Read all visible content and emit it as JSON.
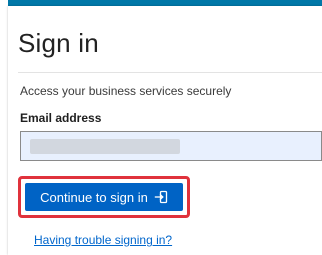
{
  "signin": {
    "title": "Sign in",
    "subtitle": "Access your business services securely",
    "email_label": "Email address",
    "email_value": "",
    "continue_label": "Continue to sign in",
    "continue_icon": "sign-in-arrow-icon",
    "trouble_link": "Having trouble signing in?"
  },
  "colors": {
    "accent_bar": "#0078a8",
    "primary_button": "#0063c5",
    "highlight": "#e0323c",
    "link": "#0066cc",
    "input_background": "#e8f0fe"
  }
}
